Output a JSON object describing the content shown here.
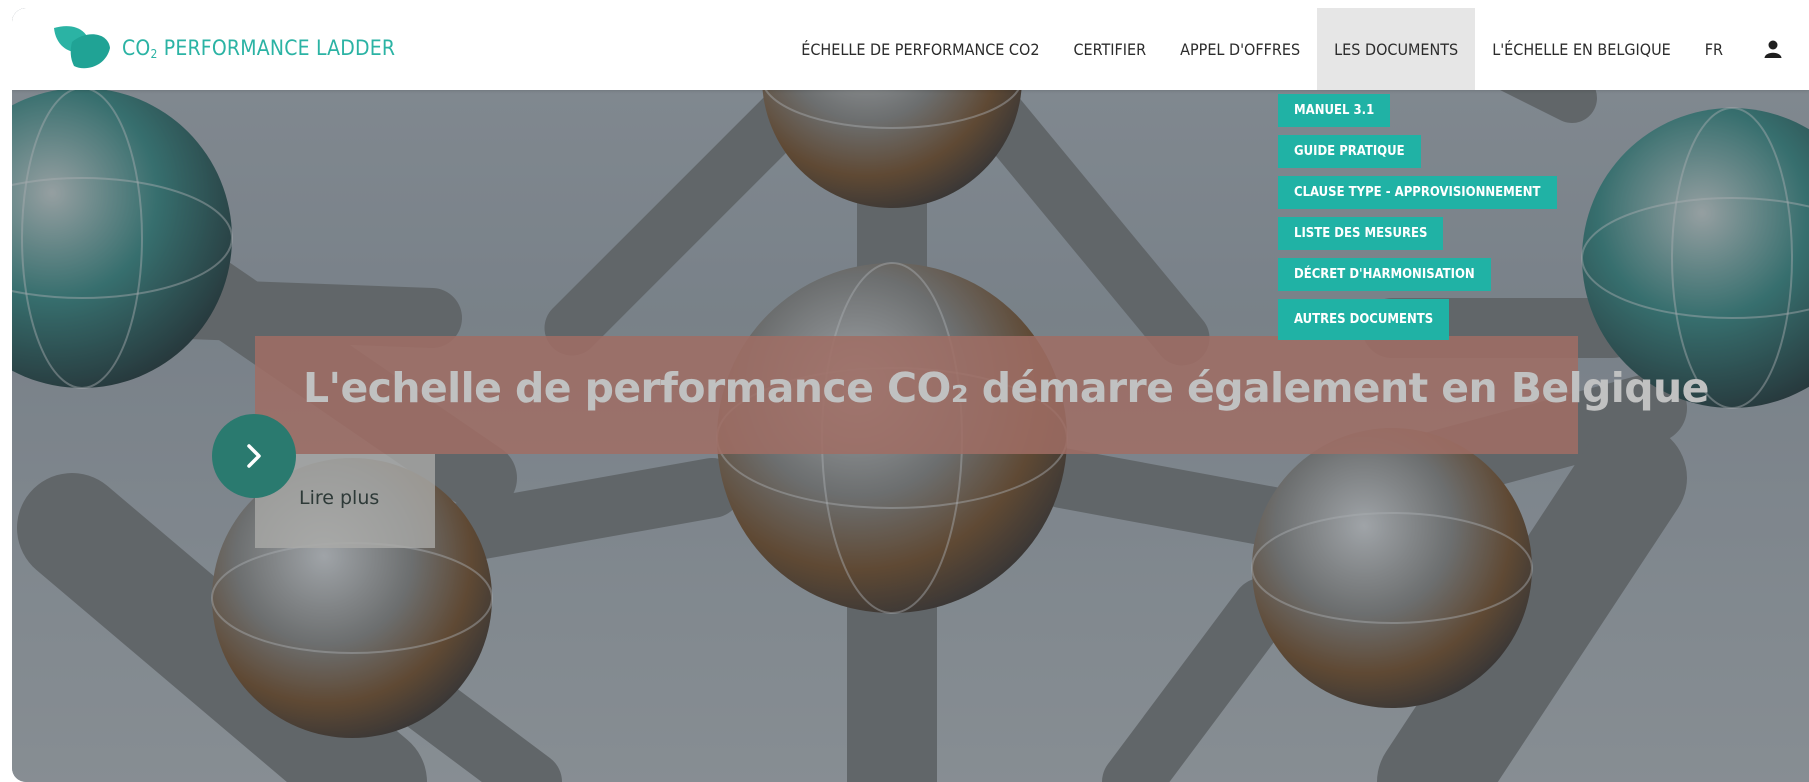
{
  "logo": {
    "text_main": "CO",
    "text_sub": "2",
    "text_rest": " PERFORMANCE LADDER",
    "accent_color": "#2bb3a4"
  },
  "nav": {
    "items": [
      {
        "label": "ÉCHELLE DE PERFORMANCE CO2"
      },
      {
        "label": "CERTIFIER"
      },
      {
        "label": "APPEL D'OFFRES"
      },
      {
        "label": "LES DOCUMENTS",
        "active": true
      },
      {
        "label": "L'ÉCHELLE EN BELGIQUE"
      },
      {
        "label": "FR"
      }
    ],
    "user_icon": "user-icon"
  },
  "dropdown": {
    "items": [
      {
        "label": "MANUEL 3.1"
      },
      {
        "label": "GUIDE PRATIQUE"
      },
      {
        "label": "CLAUSE TYPE - APPROVISIONNEMENT"
      },
      {
        "label": "LISTE DES MESURES"
      },
      {
        "label": "DÉCRET D'HARMONISATION"
      },
      {
        "label": "AUTRES DOCUMENTS"
      }
    ],
    "color": "#20b2a5"
  },
  "hero": {
    "title": "L'echelle de performance CO₂ démarre également en Belgique",
    "read_more": "Lire plus",
    "arrow_icon": "chevron-right-icon",
    "banner_color": "#a06e64",
    "button_color": "#2a7a6f"
  }
}
